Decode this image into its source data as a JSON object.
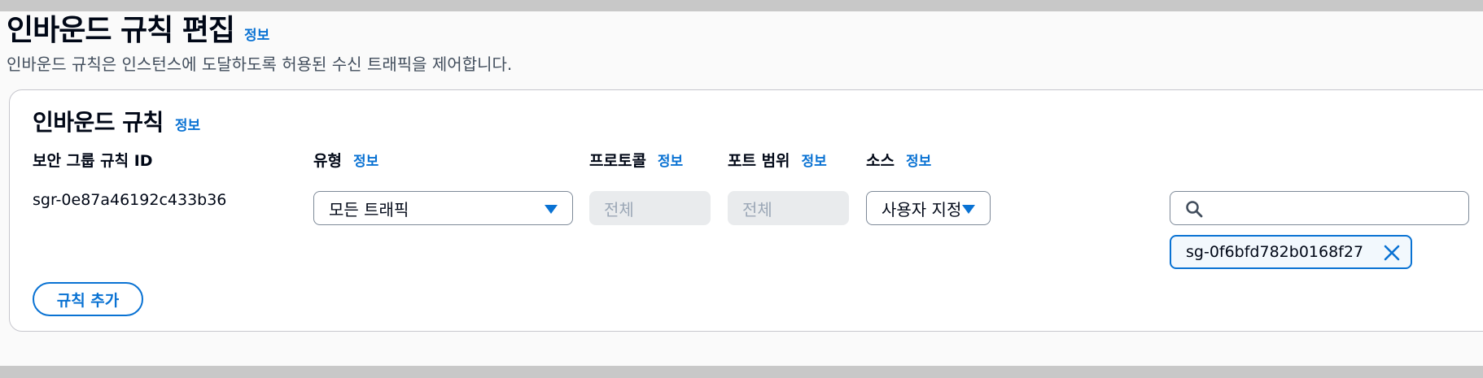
{
  "header": {
    "title": "인바운드 규칙 편집",
    "info_link": "정보",
    "description": "인바운드 규칙은 인스턴스에 도달하도록 허용된 수신 트래픽을 제어합니다."
  },
  "panel": {
    "title": "인바운드 규칙",
    "info_link": "정보",
    "columns": {
      "rule_id": {
        "label": "보안 그룹 규칙 ID"
      },
      "type": {
        "label": "유형",
        "info_link": "정보"
      },
      "protocol": {
        "label": "프로토콜",
        "info_link": "정보"
      },
      "port_range": {
        "label": "포트 범위",
        "info_link": "정보"
      },
      "source": {
        "label": "소스",
        "info_link": "정보"
      }
    },
    "rules": [
      {
        "rule_id": "sgr-0e87a46192c433b36",
        "type": "모든 트래픽",
        "protocol": "전체",
        "port_range": "전체",
        "source_type": "사용자 지정",
        "source_search_value": "",
        "source_token": "sg-0f6bfd782b0168f27"
      }
    ],
    "add_rule_label": "규칙 추가"
  },
  "icons": {
    "dropdown": "caret-down-icon",
    "search": "search-icon",
    "remove": "close-icon"
  },
  "colors": {
    "accent": "#0972d3",
    "text": "#000716",
    "disabled_bg": "#e9ebed",
    "disabled_text": "#9ba7b6"
  }
}
